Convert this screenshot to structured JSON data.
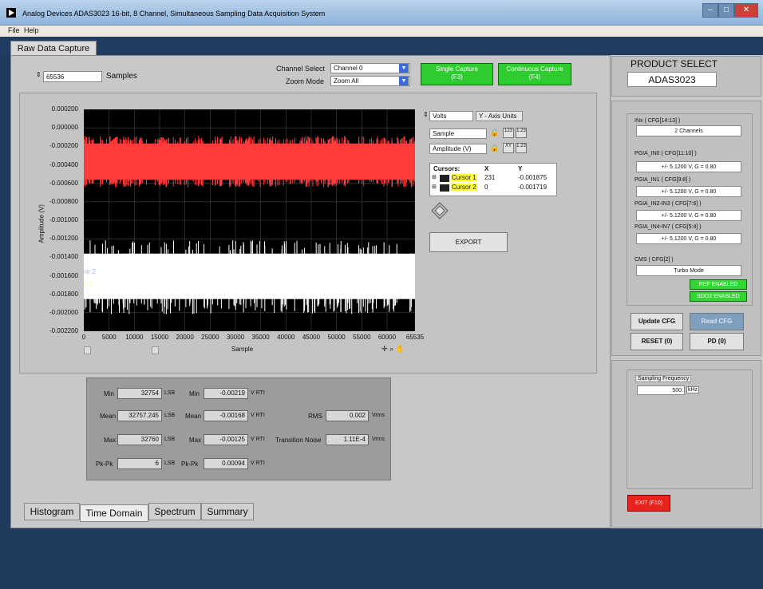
{
  "window": {
    "title": "Analog Devices ADAS3023 16-bit, 8 Channel, Simultaneous Sampling Data Acquisition System"
  },
  "menu": [
    "File",
    "Help"
  ],
  "top_tab": "Raw Data Capture",
  "controls": {
    "samples_value": "65536",
    "samples_label": "Samples",
    "channel_select_label": "Channel Select",
    "channel_select_value": "Channel 0",
    "zoom_mode_label": "Zoom Mode",
    "zoom_mode_value": "Zoom All",
    "single_capture": [
      "Single Capture",
      "(F3)"
    ],
    "continuous_capture": [
      "Continuous Capture",
      "(F4)"
    ]
  },
  "plot_side": {
    "units_value": "Volts",
    "units_label": "Y - Axis Units",
    "x_name": "Sample",
    "y_name": "Amplitude (V)",
    "cursor_headers": [
      "Cursors:",
      "X",
      "Y"
    ],
    "cursors": [
      {
        "name": "Cursor 1",
        "x": "231",
        "y": "-0.001875"
      },
      {
        "name": "Cursor 2",
        "x": "0",
        "y": "-0.001719"
      }
    ],
    "export_label": "EXPORT"
  },
  "chart_data": {
    "type": "line",
    "xlabel": "Sample",
    "ylabel": "Amplitude (V)",
    "xlim": [
      0,
      65535
    ],
    "ylim": [
      -0.0022,
      0.0002
    ],
    "x_ticks": [
      "0",
      "5000",
      "10000",
      "15000",
      "20000",
      "25000",
      "30000",
      "35000",
      "40000",
      "45000",
      "50000",
      "55000",
      "60000",
      "65535"
    ],
    "y_ticks": [
      "0.000200",
      "0.000000",
      "-0.000200",
      "-0.000400",
      "-0.000600",
      "-0.000800",
      "-0.001000",
      "-0.001200",
      "-0.001400",
      "-0.001600",
      "-0.001800",
      "-0.002000",
      "-0.002200"
    ],
    "series": [
      {
        "color": "#ff3b3b",
        "band": [
          -0.00063,
          -0.0001
        ]
      },
      {
        "color": "#ffffff",
        "band": [
          -0.00199,
          -0.00124
        ]
      }
    ],
    "cursor_labels": [
      "or 2",
      "r 1"
    ],
    "grid": true
  },
  "stats": {
    "lsb": [
      {
        "label": "Min",
        "value": "32754",
        "unit": "LSB"
      },
      {
        "label": "Mean",
        "value": "32757.245",
        "unit": "LSB"
      },
      {
        "label": "Max",
        "value": "32760",
        "unit": "LSB"
      },
      {
        "label": "Pk-Pk",
        "value": "6",
        "unit": "LSB"
      }
    ],
    "volts": [
      {
        "label": "Min",
        "value": "-0.00219",
        "unit": "V RTI"
      },
      {
        "label": "Mean",
        "value": "-0.00168",
        "unit": "V RTI"
      },
      {
        "label": "Max",
        "value": "-0.00125",
        "unit": "V RTI"
      },
      {
        "label": "Pk-Pk",
        "value": "0.00094",
        "unit": "V RTI"
      }
    ],
    "rms_label": "RMS",
    "rms_value": "0.002",
    "rms_unit": "Vrms",
    "tn_label": "Transition Noise",
    "tn_value": "1.11E-4",
    "tn_unit": "Vrms"
  },
  "bottom_tabs": [
    "Histogram",
    "Time Domain",
    "Spectrum",
    "Summary"
  ],
  "right": {
    "product_select_label": "PRODUCT SELECT",
    "product_value": "ADAS3023",
    "inx_label": "INx ( CFG[14:13] )",
    "inx_value": "2 Channels",
    "pgia": [
      {
        "label": "PGIA_IN0      ( CFG[11:10] )",
        "value": "+/-  5.1200 V, G = 0.80"
      },
      {
        "label": "PGIA_IN1       ( CFG[9:8] )",
        "value": "+/-  5.1200 V, G = 0.80"
      },
      {
        "label": "PGIA_IN2-IN3 ( CFG[7:6] )",
        "value": "+/-  5.1200 V, G = 0.80"
      },
      {
        "label": "PGIA_IN4-IN7 ( CFG[5:4] )",
        "value": "+/-  5.1200 V, G = 0.80"
      }
    ],
    "cms_label": "CMS ( CFG[2] )",
    "cms_value": "Turbo Mode",
    "ref_enabled": "REF ENABLED",
    "sdo2_enabled": "SDO2 ENABLED",
    "update_cfg": "Update CFG",
    "read_cfg": "Read CFG",
    "reset": "RESET (0)",
    "pd": "PD (0)",
    "sampling_label": "Sampling Frequency",
    "sampling_value": "500",
    "sampling_unit": "kHz",
    "exit": "EXIT (F10)"
  }
}
